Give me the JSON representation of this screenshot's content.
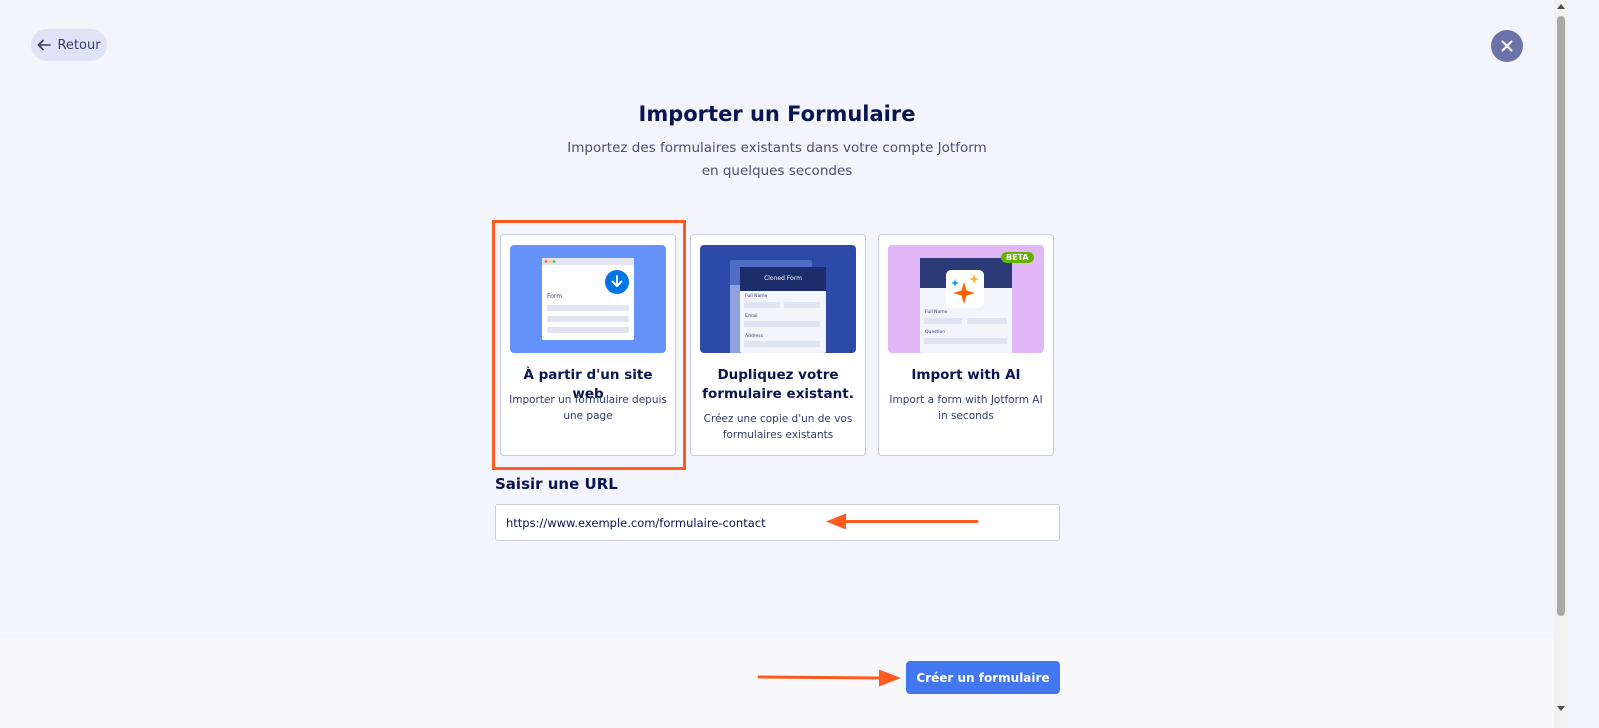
{
  "header": {
    "back_label": "Retour",
    "close_icon": "close-icon",
    "back_icon": "arrow-left-icon"
  },
  "main": {
    "title": "Importer un Formulaire",
    "subtitle": "Importez des formulaires existants dans votre compte Jotform en quelques secondes"
  },
  "cards": [
    {
      "title": "À partir d'un site web",
      "description": "Importer un formulaire depuis une page",
      "illustration": {
        "form_label": "Form",
        "icon": "download-icon"
      }
    },
    {
      "title": "Dupliquez votre formulaire existant.",
      "description": "Créez une copie d'un de vos formulaires existants",
      "illustration": {
        "header": "Cloned Form",
        "fields": [
          "Full Name",
          "Email",
          "Address"
        ]
      }
    },
    {
      "title": "Import with AI",
      "description": "Import a form with Jotform AI in seconds",
      "illustration": {
        "badge": "BETA",
        "fields": [
          "Full Name",
          "Question"
        ],
        "icon": "sparkle-icon"
      }
    }
  ],
  "url_section": {
    "label": "Saisir une URL",
    "value": "https://www.exemple.com/formulaire-contact"
  },
  "footer": {
    "create_label": "Créer un formulaire"
  },
  "colors": {
    "page_bg": "#f3f4fc",
    "primary": "#4277f0",
    "annotation": "#ff5a1f",
    "navy": "#0a1551"
  }
}
